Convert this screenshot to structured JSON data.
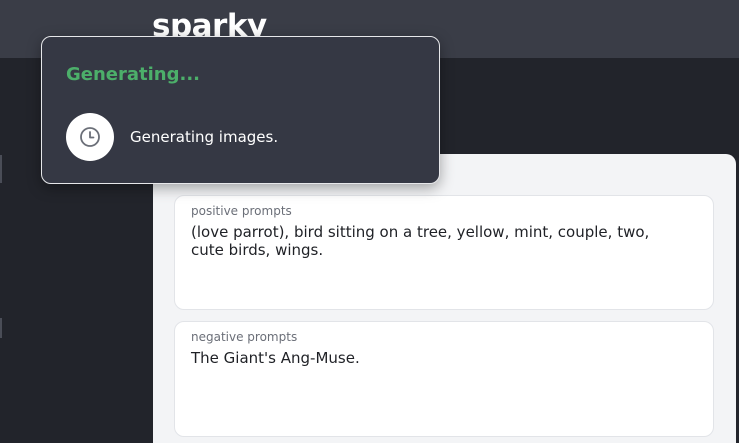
{
  "header": {
    "logo_text": "sparky"
  },
  "toast": {
    "title": "Generating...",
    "message": "Generating images.",
    "icon": "clock-icon",
    "title_color": "#4caf6a"
  },
  "prompts": {
    "positive": {
      "label": "positive prompts",
      "value": "(love parrot), bird sitting on a tree, yellow, mint, couple, two, cute birds, wings."
    },
    "negative": {
      "label": "negative prompts",
      "value": "The Giant's Ang-Muse."
    }
  }
}
